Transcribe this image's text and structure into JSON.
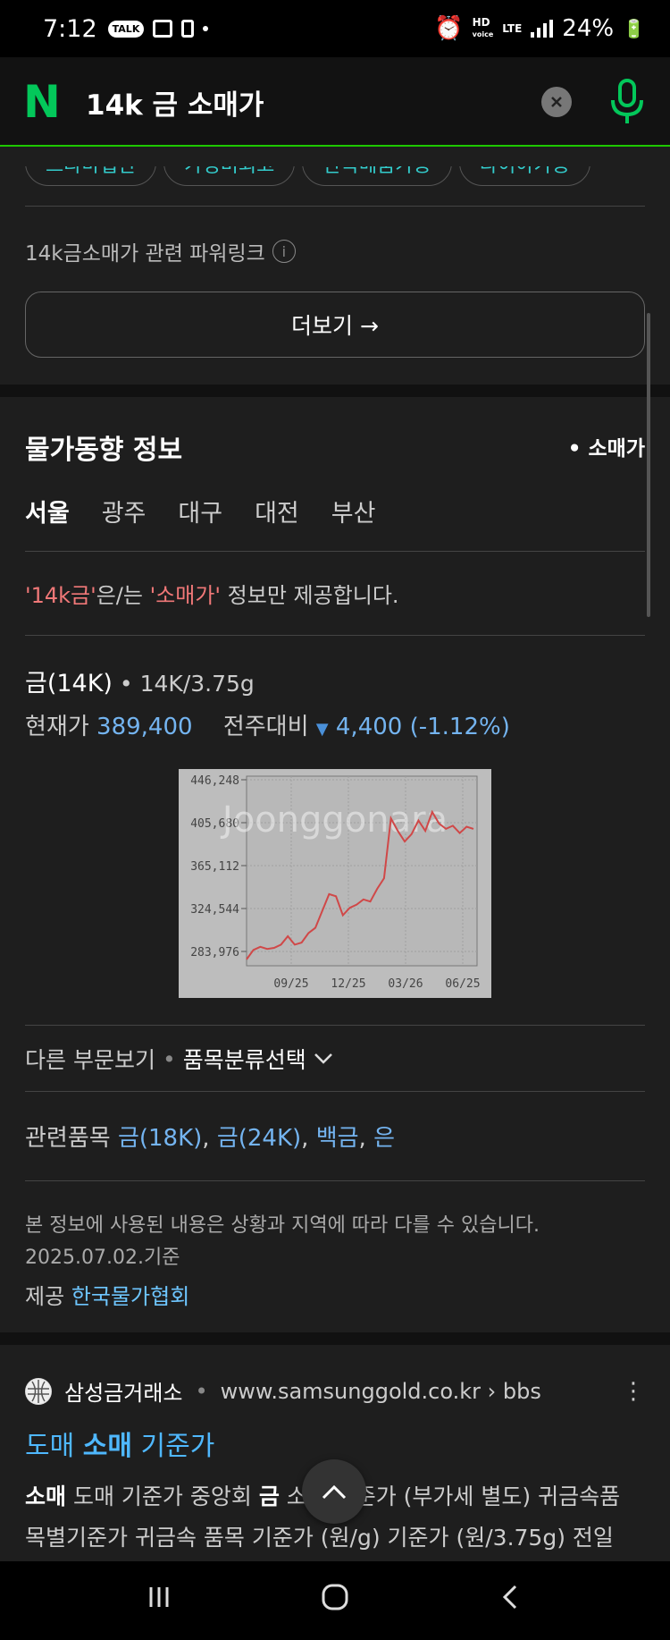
{
  "status_bar": {
    "time": "7:12",
    "talk": "TALK",
    "hd": "HD",
    "voice": "voice",
    "lte": "LTE",
    "battery": "24%"
  },
  "search": {
    "query": "14k 금 소매가"
  },
  "chips": [
    "드라마협찬",
    "가성비최고",
    "안쪽메뚬가능",
    "다이아가능"
  ],
  "powerlink": {
    "label": "14k금소매가 관련 파워링크",
    "more": "더보기 →"
  },
  "price_info": {
    "title": "물가동향 정보",
    "type": "• 소매가",
    "cities": [
      "서울",
      "광주",
      "대구",
      "대전",
      "부산"
    ],
    "notice_item": "'14k금'",
    "notice_mid": "은/는 ",
    "notice_type": "'소매가'",
    "notice_end": " 정보만 제공합니다.",
    "item_name": "금(14K)",
    "item_unit": " • 14K/3.75g",
    "current_label": "현재가",
    "current_value": "389,400",
    "compare_label": "전주대비",
    "change": "4,400 (-1.12%)",
    "other_view": "다른 부문보기",
    "category_select": "품목분류선택",
    "related_label": "관련품목",
    "related_items": [
      "금(18K)",
      "금(24K)",
      "백금",
      "은"
    ],
    "disclaimer": "본 정보에 사용된 내용은 상황과 지역에 따라 다를 수 있습니다.",
    "date": "2025.07.02.기준",
    "provider_label": "제공",
    "provider": "한국물가협회"
  },
  "chart_data": {
    "type": "line",
    "y_ticks": [
      "446,248",
      "405,680",
      "365,112",
      "324,544",
      "283,976"
    ],
    "x_ticks": [
      "09/25",
      "12/25",
      "03/26",
      "06/25"
    ],
    "watermark": "Joonggonara",
    "values": [
      276000,
      285000,
      288000,
      286000,
      287000,
      290000,
      298000,
      290000,
      292000,
      301000,
      306000,
      322000,
      338000,
      336000,
      318000,
      325000,
      328000,
      333000,
      331000,
      343000,
      353000,
      410000,
      398000,
      388000,
      395000,
      408000,
      398000,
      416000,
      405000,
      400000,
      403000,
      396000,
      402000,
      400000
    ],
    "ylim": [
      270000,
      450000
    ],
    "line_color": "#d04848"
  },
  "result": {
    "site": "삼성금거래소",
    "url": "www.samsunggold.co.kr › bbs",
    "title_a": "도매 ",
    "title_b": "소매",
    "title_c": " 기준가",
    "snippet1_b": "소매",
    "snippet1_a": " 도매 기준가 중앙회 ",
    "snippet1_c": "금",
    "snippet1_d": " 소매 기준가 (부가세 별도) 귀금속품",
    "snippet2": "목별기준가 귀금속 품목 기준가 (원/g) 기준가 (원/3.75g) 전일"
  }
}
